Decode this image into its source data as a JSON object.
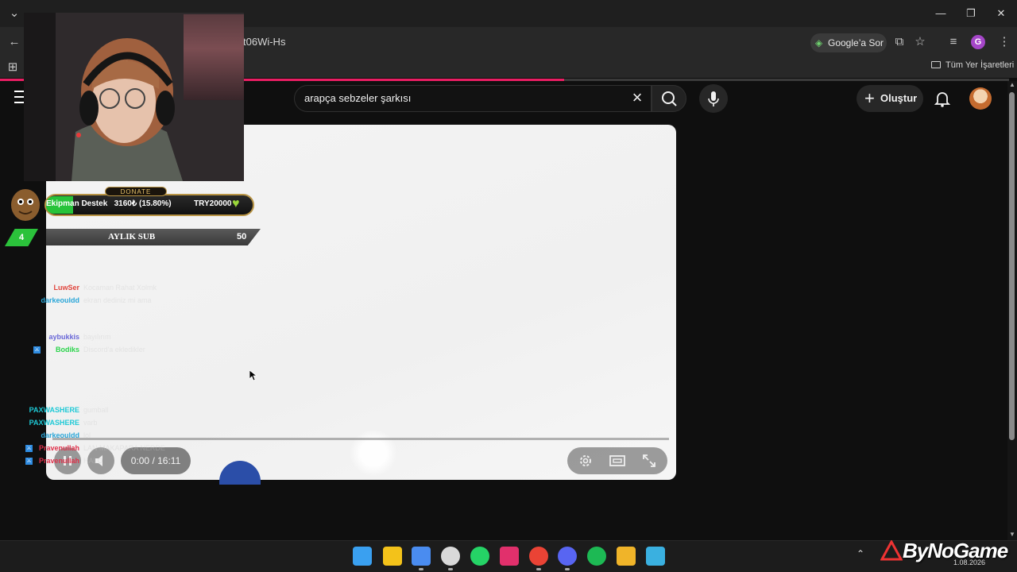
{
  "browser": {
    "url_fragment": "t06Wi-Hs",
    "google_ask": "Google’a Sor",
    "profile_letter": "G",
    "all_bookmarks": "Tüm Yer İşaretleri",
    "window_controls": [
      "minimize-icon",
      "restore-icon",
      "close-icon"
    ]
  },
  "youtube": {
    "search_query": "arapça sebzeler şarkısı",
    "create_label": "Oluştur",
    "icons": [
      "menu-icon",
      "clear-icon",
      "search-icon",
      "mic-icon",
      "plus-icon",
      "bell-icon",
      "avatar"
    ]
  },
  "player": {
    "time": "0:00 / 16:11",
    "controls": [
      "play-pause-icon",
      "mute-icon",
      "settings-icon",
      "theater-mode-icon",
      "fullscreen-icon"
    ],
    "progress": 0
  },
  "overlay": {
    "donate_tag": "DONATE",
    "donate_goal": "Ekipman Destek",
    "donate_progress": "3160₺ (15.80%)",
    "donate_target": "TRY20000",
    "donate_fraction": 0.158,
    "sub_label": "AYLIK SUB",
    "sub_count": "50",
    "sub_current": "4"
  },
  "chat": [
    {
      "name": "LuwSer",
      "color": "#e0443c",
      "msg": "Kocaman Rahat Xolmk"
    },
    {
      "name": "darkeouldd",
      "color": "#2aa6d8",
      "msg": "ekran dediniz mi ama"
    },
    {
      "name": "aybukkis",
      "color": "#6b69d8",
      "msg": "bayılırım"
    },
    {
      "name": "Bodiks",
      "color": "#2bd44b",
      "msg": "Discord'a ekledikler"
    },
    {
      "name": "PAXWASHERE",
      "color": "#1ec9d6",
      "msg": "gumball"
    },
    {
      "name": "PAXWASHERE",
      "color": "#1ec9d6",
      "msg": "varb"
    },
    {
      "name": "darkeouldd",
      "color": "#2aa6d8",
      "msg": "lol"
    },
    {
      "name": "Pravenullah",
      "color": "#e0304a",
      "msg": "LAN MAKAPARA NERDE"
    },
    {
      "name": "Pravenullah",
      "color": "#e0304a",
      "msg": "HALO"
    }
  ],
  "taskbar": {
    "apps": [
      "windows-start-icon",
      "sticky-notes-icon",
      "snipping-tool-icon",
      "obs-icon",
      "whatsapp-icon",
      "instagram-icon",
      "chrome-icon",
      "discord-icon",
      "spotify-icon",
      "file-explorer-icon",
      "app-icon"
    ],
    "date": "1.08.2026"
  },
  "watermark": "ByNoGame"
}
